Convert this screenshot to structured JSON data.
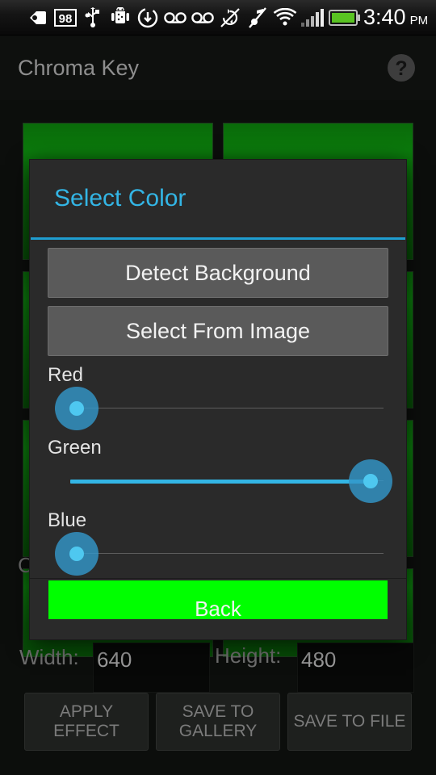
{
  "statusbar": {
    "icons": [
      {
        "name": "back-arrow-icon"
      },
      {
        "name": "battery-percent-98-icon",
        "label": "98"
      },
      {
        "name": "usb-icon"
      },
      {
        "name": "android-debug-icon"
      },
      {
        "name": "download-icon"
      },
      {
        "name": "voicemail-icon"
      },
      {
        "name": "voicemail-icon-2"
      },
      {
        "name": "rotation-locked-icon"
      },
      {
        "name": "silent-mode-icon"
      },
      {
        "name": "wifi-icon"
      },
      {
        "name": "signal-bars-icon"
      },
      {
        "name": "battery-icon"
      }
    ],
    "battery_percent": "98",
    "clock_time": "3:40",
    "clock_ampm": "PM"
  },
  "titlebar": {
    "title": "Chroma Key",
    "help_icon": "help-question-icon"
  },
  "background": {
    "width_label": "Width:",
    "width_value": "640",
    "height_label": "Height:",
    "height_value": "480",
    "color_label": "C",
    "buttons": [
      {
        "name": "apply-effect-button",
        "label": "APPLY EFFECT"
      },
      {
        "name": "save-to-gallery-button",
        "label": "SAVE TO GALLERY"
      },
      {
        "name": "save-to-file-button",
        "label": "SAVE TO FILE"
      }
    ],
    "thumbnail_color": "#0a6a0a"
  },
  "dialog": {
    "title": "Select Color",
    "accent_color": "#33b5e5",
    "detect_background_label": "Detect Background",
    "select_from_image_label": "Select From Image",
    "sliders": [
      {
        "name": "red-slider",
        "label": "Red",
        "value": 0,
        "max": 255,
        "percent": 0
      },
      {
        "name": "green-slider",
        "label": "Green",
        "value": 255,
        "max": 255,
        "percent": 100
      },
      {
        "name": "blue-slider",
        "label": "Blue",
        "value": 0,
        "max": 255,
        "percent": 0
      }
    ],
    "preview_color": "#00FF00",
    "back_label": "Back"
  }
}
